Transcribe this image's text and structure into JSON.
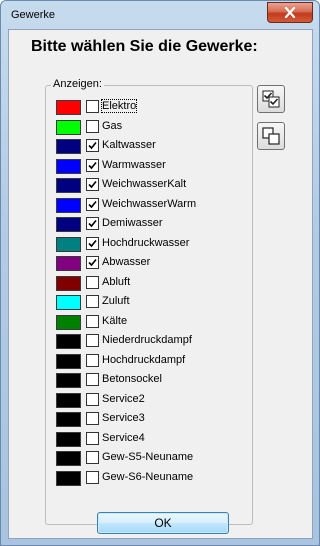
{
  "window": {
    "title": "Gewerke",
    "close_label": "x"
  },
  "heading": "Bitte wählen Sie die Gewerke:",
  "group_label": "Anzeigen:",
  "items": [
    {
      "label": "Elektro",
      "checked": false,
      "color": "#ff0000"
    },
    {
      "label": "Gas",
      "checked": false,
      "color": "#00ff00"
    },
    {
      "label": "Kaltwasser",
      "checked": true,
      "color": "#000080"
    },
    {
      "label": "Warmwasser",
      "checked": true,
      "color": "#0000ff"
    },
    {
      "label": "WeichwasserKalt",
      "checked": true,
      "color": "#000080"
    },
    {
      "label": "WeichwasserWarm",
      "checked": true,
      "color": "#0000ff"
    },
    {
      "label": "Demiwasser",
      "checked": true,
      "color": "#000080"
    },
    {
      "label": "Hochdruckwasser",
      "checked": true,
      "color": "#008080"
    },
    {
      "label": "Abwasser",
      "checked": true,
      "color": "#800080"
    },
    {
      "label": "Abluft",
      "checked": false,
      "color": "#800000"
    },
    {
      "label": "Zuluft",
      "checked": false,
      "color": "#00ffff"
    },
    {
      "label": "Kälte",
      "checked": false,
      "color": "#008000"
    },
    {
      "label": "Niederdruckdampf",
      "checked": false,
      "color": "#000000"
    },
    {
      "label": "Hochdruckdampf",
      "checked": false,
      "color": "#000000"
    },
    {
      "label": "Betonsockel",
      "checked": false,
      "color": "#000000"
    },
    {
      "label": "Service2",
      "checked": false,
      "color": "#000000"
    },
    {
      "label": "Service3",
      "checked": false,
      "color": "#000000"
    },
    {
      "label": "Service4",
      "checked": false,
      "color": "#000000"
    },
    {
      "label": "Gew-S5-Neuname",
      "checked": false,
      "color": "#000000"
    },
    {
      "label": "Gew-S6-Neuname",
      "checked": false,
      "color": "#000000"
    }
  ],
  "buttons": {
    "ok_label": "OK",
    "select_all_icon": "check-all-icon",
    "deselect_all_icon": "uncheck-all-icon"
  }
}
